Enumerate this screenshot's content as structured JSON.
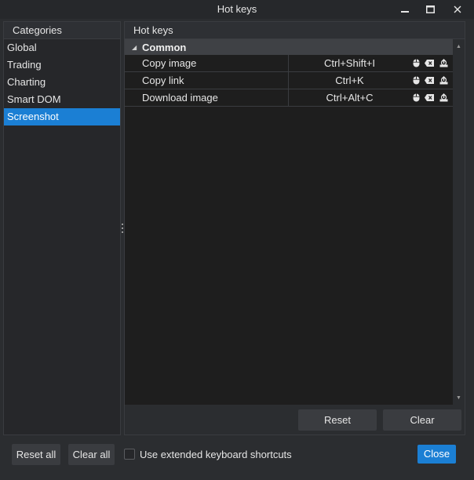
{
  "window": {
    "title": "Hot keys"
  },
  "categories": {
    "header": "Categories",
    "items": [
      {
        "label": "Global",
        "selected": false
      },
      {
        "label": "Trading",
        "selected": false
      },
      {
        "label": "Charting",
        "selected": false
      },
      {
        "label": "Smart DOM",
        "selected": false
      },
      {
        "label": "Screenshot",
        "selected": true
      }
    ]
  },
  "hotkeys": {
    "header": "Hot keys",
    "group": "Common",
    "rows": [
      {
        "name": "Copy image",
        "key": "Ctrl+Shift+I"
      },
      {
        "name": "Copy link",
        "key": "Ctrl+K"
      },
      {
        "name": "Download image",
        "key": "Ctrl+Alt+C"
      }
    ],
    "row_icons": [
      "mouse-icon",
      "clear-key-icon",
      "reset-key-icon"
    ]
  },
  "panel_buttons": {
    "reset": "Reset",
    "clear": "Clear"
  },
  "footer": {
    "reset_all": "Reset all",
    "clear_all": "Clear all",
    "extended_shortcuts_label": "Use extended keyboard shortcuts",
    "extended_shortcuts_checked": false,
    "close": "Close"
  },
  "colors": {
    "accent": "#1b7fd4",
    "background": "#2b2d30",
    "grid_background": "#1e1e1e"
  }
}
